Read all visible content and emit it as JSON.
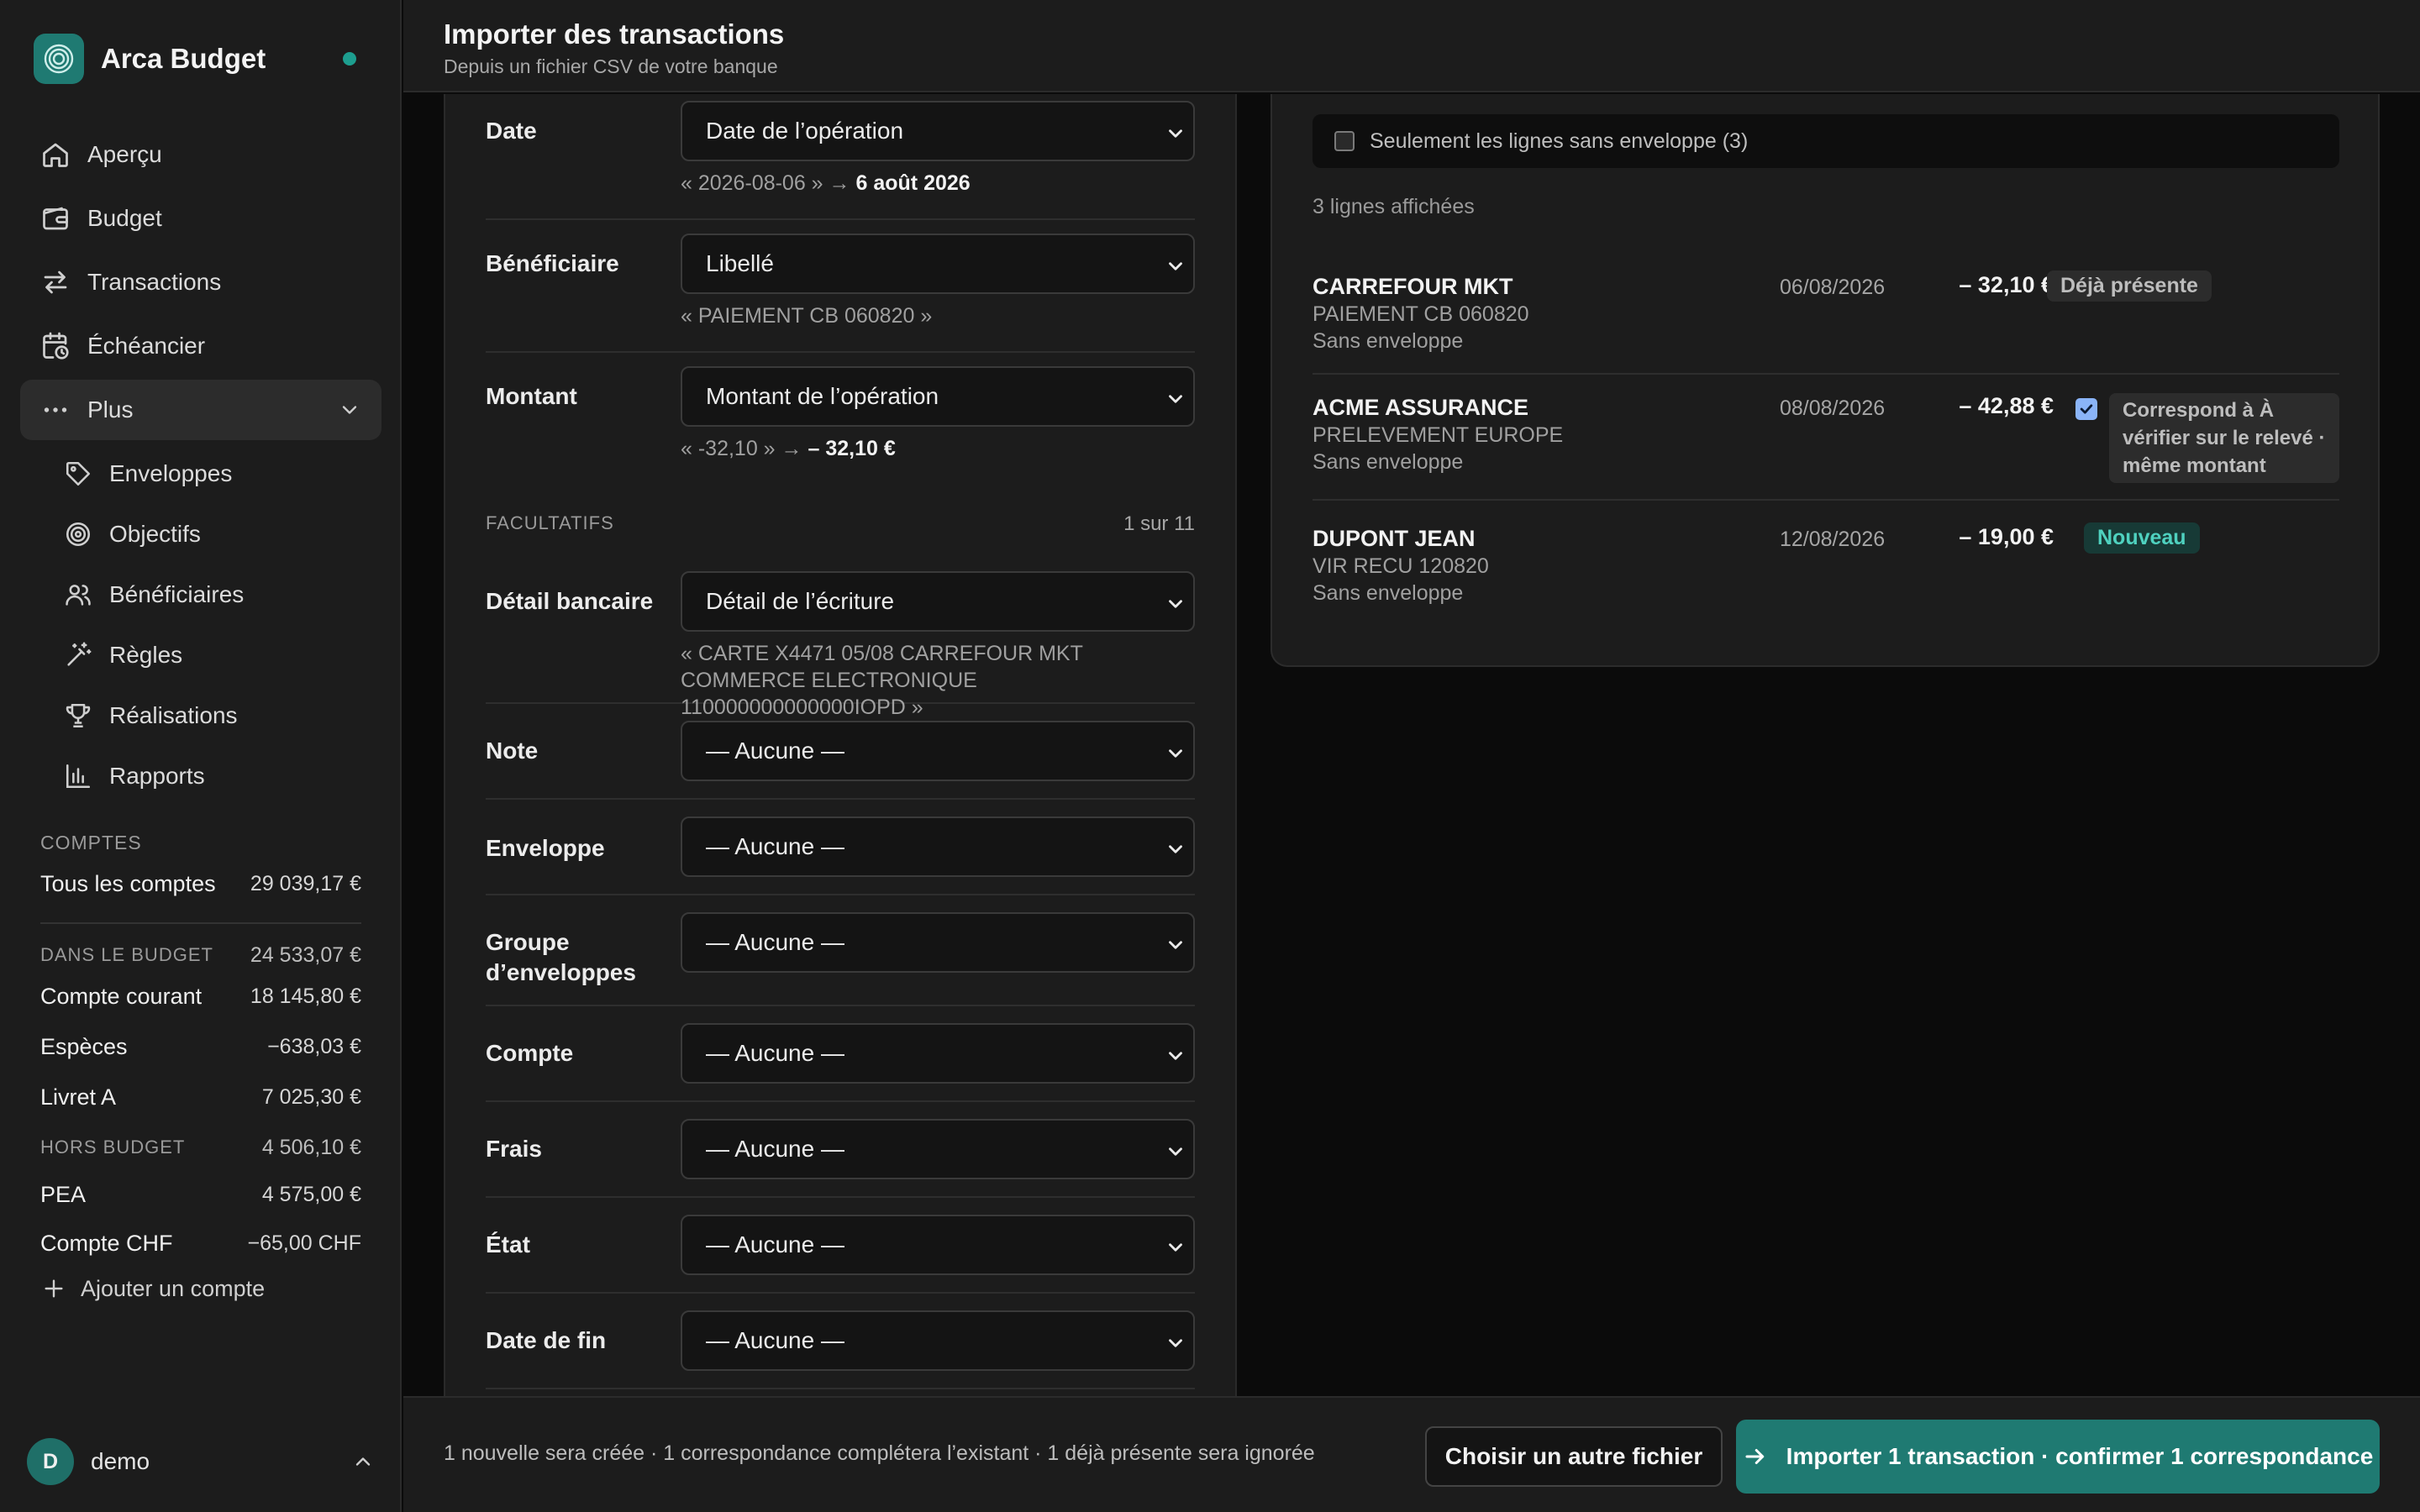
{
  "app": {
    "name": "Arca Budget"
  },
  "nav": {
    "items": [
      {
        "label": "Aperçu",
        "icon": "home-icon"
      },
      {
        "label": "Budget",
        "icon": "wallet-icon"
      },
      {
        "label": "Transactions",
        "icon": "arrows-icon"
      },
      {
        "label": "Échéancier",
        "icon": "calendar-clock-icon"
      },
      {
        "label": "Plus",
        "icon": "more-icon"
      }
    ],
    "sub_items": [
      {
        "label": "Enveloppes",
        "icon": "tag-icon"
      },
      {
        "label": "Objectifs",
        "icon": "target-icon"
      },
      {
        "label": "Bénéficiaires",
        "icon": "users-icon"
      },
      {
        "label": "Règles",
        "icon": "wand-icon"
      },
      {
        "label": "Réalisations",
        "icon": "trophy-icon"
      },
      {
        "label": "Rapports",
        "icon": "bar-chart-icon"
      }
    ]
  },
  "accounts": {
    "heading": "COMPTES",
    "all": {
      "label": "Tous les comptes",
      "amount": "29 039,17 €"
    },
    "in_budget": {
      "label": "DANS LE BUDGET",
      "amount": "24 533,07 €"
    },
    "budget_accounts": [
      {
        "label": "Compte courant",
        "amount": "18 145,80 €"
      },
      {
        "label": "Espèces",
        "amount": "−638,03 €"
      },
      {
        "label": "Livret A",
        "amount": "7 025,30 €"
      }
    ],
    "off_budget": {
      "label": "HORS BUDGET",
      "amount": "4 506,10 €"
    },
    "off_accounts": [
      {
        "label": "PEA",
        "amount": "4 575,00 €"
      },
      {
        "label": "Compte CHF",
        "amount": "−65,00 CHF"
      }
    ],
    "add_label": "Ajouter un compte"
  },
  "user": {
    "initial": "D",
    "name": "demo"
  },
  "header": {
    "title": "Importer des transactions",
    "subtitle": "Depuis un fichier CSV de votre banque"
  },
  "mapping": {
    "date": {
      "label": "Date",
      "value": "Date de l’opération",
      "preview_raw": "« 2026-08-06 »",
      "arrow": "→",
      "preview_parsed": "6 août 2026"
    },
    "payee": {
      "label": "Bénéficiaire",
      "value": "Libellé",
      "preview_raw": "« PAIEMENT CB 060820 »"
    },
    "amount": {
      "label": "Montant",
      "value": "Montant de l’opération",
      "preview_raw": "« -32,10 »",
      "arrow": "→",
      "preview_parsed": "– 32,10 €"
    },
    "optional": {
      "label": "FACULTATIFS",
      "count": "1 sur 11"
    },
    "bank_detail": {
      "label": "Détail bancaire",
      "value": "Détail de l’écriture",
      "preview_raw": "« CARTE X4471 05/08 CARREFOUR MKT COMMERCE ELECTRONIQUE 110000000000000IOPD »"
    },
    "note": {
      "label": "Note",
      "value": "— Aucune —"
    },
    "envelope": {
      "label": "Enveloppe",
      "value": "— Aucune —"
    },
    "envelope_group": {
      "label": "Groupe d’enveloppes",
      "value": "— Aucune —"
    },
    "account": {
      "label": "Compte",
      "value": "— Aucune —"
    },
    "fees": {
      "label": "Frais",
      "value": "— Aucune —"
    },
    "state": {
      "label": "État",
      "value": "— Aucune —"
    },
    "end_date": {
      "label": "Date de fin",
      "value": "— Aucune —"
    }
  },
  "preview": {
    "filter_label": "Seulement les lignes sans enveloppe (3)",
    "shown": "3 lignes affichées",
    "rows": [
      {
        "name": "CARREFOUR MKT",
        "detail": "PAIEMENT CB 060820",
        "envelope": "Sans enveloppe",
        "date": "06/08/2026",
        "amount": "– 32,10 €",
        "status": "Déjà présente"
      },
      {
        "name": "ACME ASSURANCE",
        "detail": "PRELEVEMENT EUROPE",
        "envelope": "Sans enveloppe",
        "date": "08/08/2026",
        "amount": "– 42,88 €",
        "match_checked": true,
        "status": "Correspond à À vérifier sur le relevé · même montant"
      },
      {
        "name": "DUPONT JEAN",
        "detail": "VIR RECU 120820",
        "envelope": "Sans enveloppe",
        "date": "12/08/2026",
        "amount": "– 19,00 €",
        "status": "Nouveau"
      }
    ]
  },
  "footer": {
    "summary": "1 nouvelle sera créée · 1 correspondance complétera l’existant · 1 déjà présente sera ignorée",
    "secondary_label": "Choisir un autre fichier",
    "primary_label": "Importer 1 transaction · confirmer 1 correspondance"
  },
  "colors": {
    "accent": "#1f7a72",
    "new_badge": "#4fd1bf",
    "background": "#1c1c1c"
  }
}
